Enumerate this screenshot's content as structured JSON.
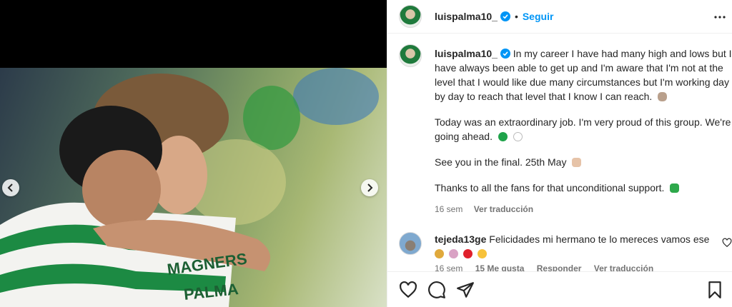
{
  "header": {
    "username": "luispalma10_",
    "separator": "•",
    "follow_label": "Seguir"
  },
  "caption": {
    "username": "luispalma10_",
    "paragraphs": [
      "In my career I have had many high and lows but I have always been able to get up and I'm aware that I'm not at the level that I would like due many circumstances but I'm working day by day to reach that level that I know I can reach.",
      "Today was an extraordinary job. I'm very proud of this group. We're going ahead.",
      "See you in the final. 25th May",
      "Thanks to all the fans for that unconditional support."
    ],
    "time": "16 sem",
    "translate_label": "Ver traducción"
  },
  "comment": {
    "username": "tejeda13ge",
    "text": "Felicidades mi hermano te lo mereces vamos ese",
    "time": "16 sem",
    "likes": "15 Me gusta",
    "reply_label": "Responder",
    "translate_label": "Ver traducción"
  },
  "icons": {
    "like": "heart-icon",
    "comment": "comment-icon",
    "share": "share-icon",
    "save": "bookmark-icon",
    "more": "more-icon",
    "verified": "verified-badge-icon"
  },
  "colors": {
    "link_blue": "#0095f6",
    "verified_blue": "#0095f6",
    "muted": "#737373",
    "text": "#262626"
  }
}
